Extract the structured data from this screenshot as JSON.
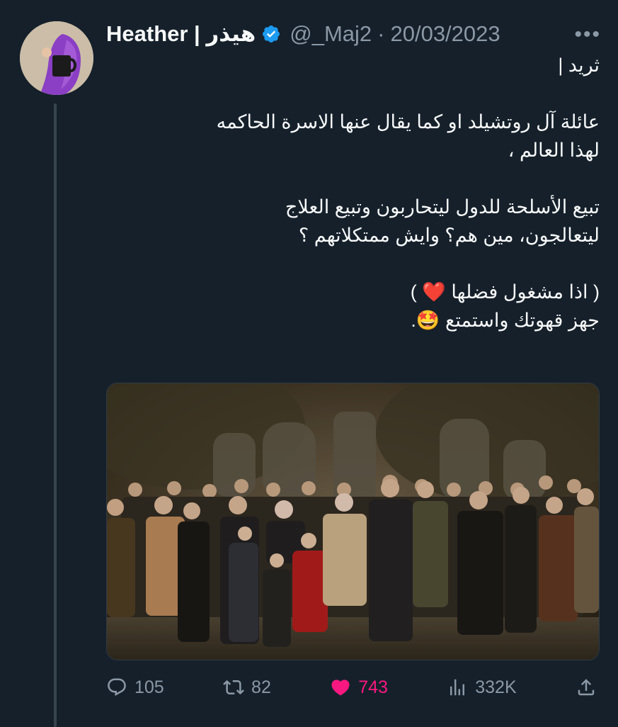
{
  "tweet": {
    "display_name": "Heather | هيذر",
    "handle": "@_Maj2",
    "separator": "·",
    "date": "20/03/2023",
    "verified": true,
    "more_icon": "more-horizontal-icon",
    "text": {
      "line1": "ثريد |",
      "para1": "عائلة آل روتشيلد او كما يقال عنها الاسرة الحاكمه\nلهذا العالم ،",
      "para2": "تبيع الأسلحة للدول ليتحاربون وتبيع العلاج\nليتعالجون، مين هم؟ وايش ممتكلاتهم ؟",
      "para3_part1": "( اذا مشغول فضلها ",
      "para3_emoji1": "❤️",
      "para3_part2": " )",
      "para4_part1": "جهز قهوتك واستمتع ",
      "para4_emoji": "🤩",
      "para4_part2": "."
    },
    "media": {
      "type": "photo",
      "description_icon": "group-photo-image"
    },
    "stats": {
      "replies": "105",
      "retweets": "82",
      "likes": "743",
      "views": "332K"
    },
    "colors": {
      "background": "#15202b",
      "text": "#f7f9f9",
      "muted": "#8b98a5",
      "verified": "#1d9bf0",
      "like": "#f91880"
    }
  }
}
